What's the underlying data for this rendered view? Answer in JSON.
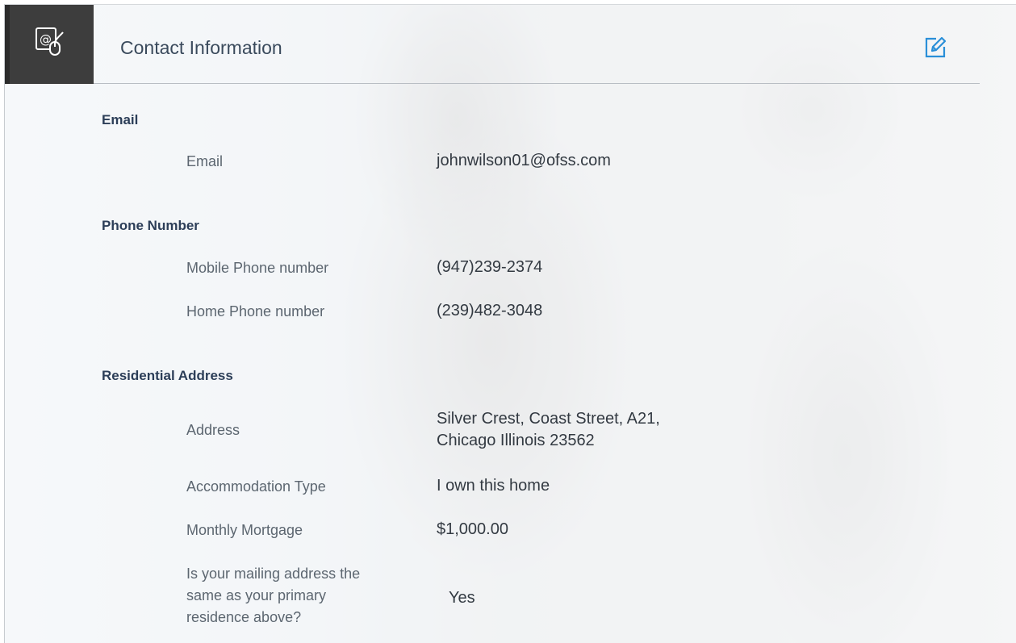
{
  "header": {
    "title": "Contact Information",
    "icon": "contact-email-icon",
    "edit_icon": "edit-icon",
    "accent_color": "#2a8fd8"
  },
  "sections": {
    "email": {
      "title": "Email",
      "fields": {
        "email": {
          "label": "Email",
          "value": "johnwilson01@ofss.com"
        }
      }
    },
    "phone": {
      "title": "Phone Number",
      "fields": {
        "mobile": {
          "label": "Mobile Phone number",
          "value": "(947)239-2374"
        },
        "home": {
          "label": "Home Phone number",
          "value": "(239)482-3048"
        }
      }
    },
    "address": {
      "title": "Residential Address",
      "fields": {
        "address": {
          "label": "Address",
          "value_line1": "Silver Crest, Coast Street, A21,",
          "value_line2": "Chicago Illinois 23562"
        },
        "accommodation": {
          "label": "Accommodation Type",
          "value": "I own this home"
        },
        "mortgage": {
          "label": "Monthly Mortgage",
          "value": "$1,000.00"
        },
        "mailing_same": {
          "label_line1": "Is your mailing address the",
          "label_line2": "same as your primary",
          "label_line3": "residence above?",
          "value": "Yes"
        }
      }
    }
  }
}
